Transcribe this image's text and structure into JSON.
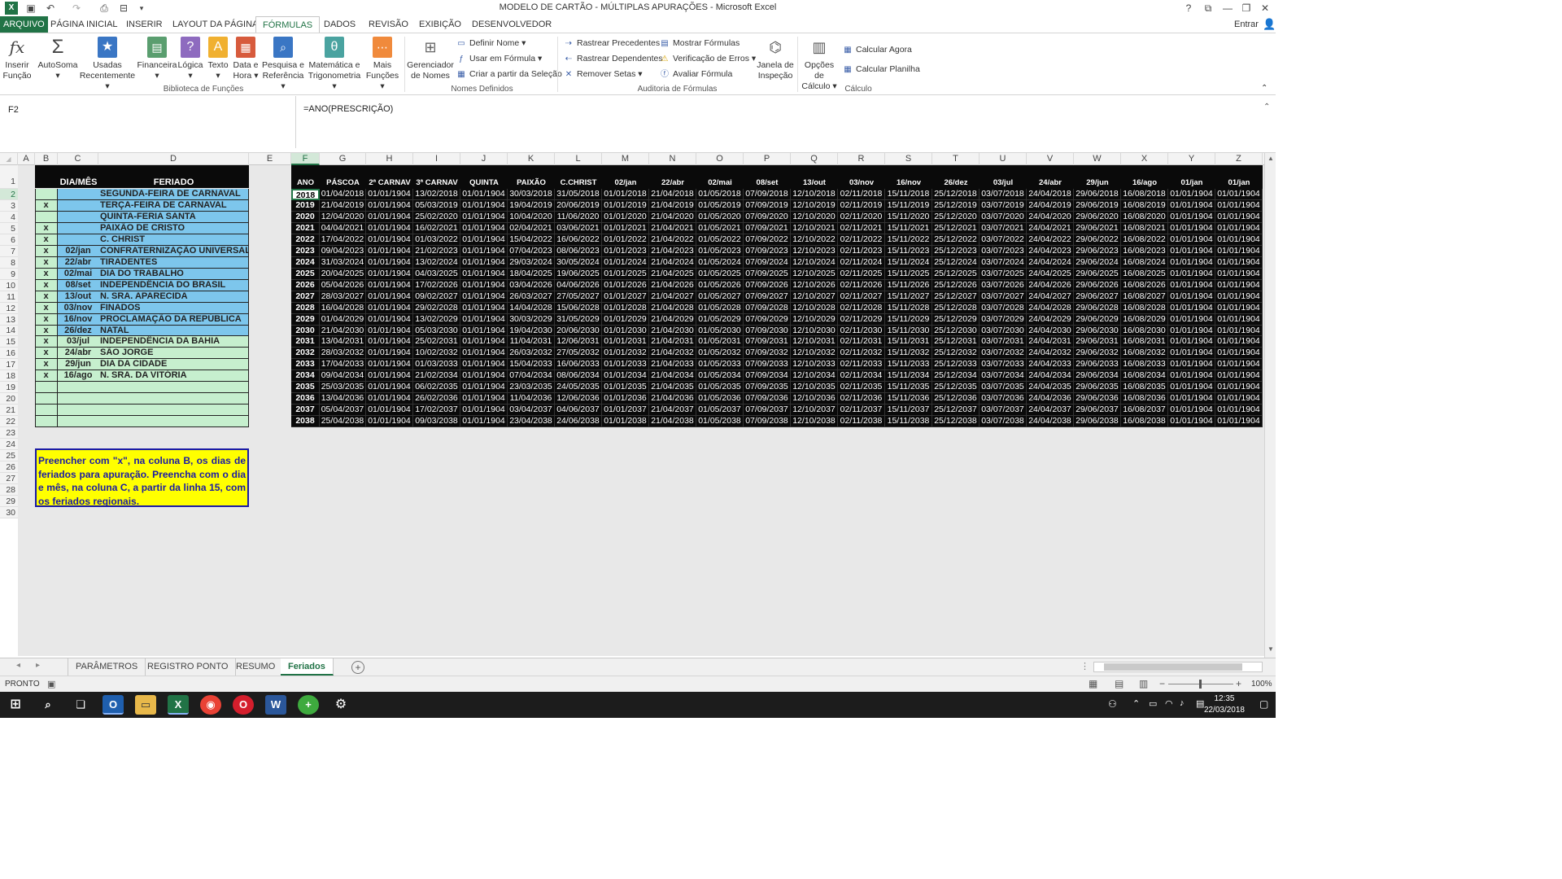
{
  "window": {
    "title": "MODELO DE CARTÃO - MÚLTIPLAS APURAÇÕES - Microsoft Excel",
    "help": "?",
    "login": "Entrar"
  },
  "ribbon_tabs": [
    "ARQUIVO",
    "PÁGINA INICIAL",
    "INSERIR",
    "LAYOUT DA PÁGINA",
    "FÓRMULAS",
    "DADOS",
    "REVISÃO",
    "EXIBIÇÃO",
    "DESENVOLVEDOR"
  ],
  "ribbon": {
    "lib_group": "Biblioteca de Funções",
    "names_group": "Nomes Definidos",
    "audit_group": "Auditoria de Fórmulas",
    "calc_group": "Cálculo",
    "buttons": {
      "inserir_funcao": [
        "Inserir",
        "Função"
      ],
      "autosoma": [
        "AutoSoma",
        "▾"
      ],
      "usadas": [
        "Usadas",
        "Recentemente ▾"
      ],
      "financeira": [
        "Financeira",
        "▾"
      ],
      "logica": [
        "Lógica",
        "▾"
      ],
      "texto": [
        "Texto",
        "▾"
      ],
      "data_hora": [
        "Data e",
        "Hora ▾"
      ],
      "pesquisa": [
        "Pesquisa e",
        "Referência ▾"
      ],
      "matematica": [
        "Matemática e",
        "Trigonometria ▾"
      ],
      "mais": [
        "Mais",
        "Funções ▾"
      ],
      "gerenciador": [
        "Gerenciador",
        "de Nomes"
      ],
      "janela": [
        "Janela de",
        "Inspeção"
      ],
      "opcoes": [
        "Opções de",
        "Cálculo ▾"
      ]
    },
    "small": {
      "definir_nome": "Definir Nome ▾",
      "usar_formula": "Usar em Fórmula ▾",
      "criar_selecao": "Criar a partir da Seleção",
      "rastrear_prec": "Rastrear Precedentes",
      "rastrear_dep": "Rastrear Dependentes",
      "remover_setas": "Remover Setas ▾",
      "mostrar_formulas": "Mostrar Fórmulas",
      "verificacao_erros": "Verificação de Erros ▾",
      "avaliar_formula": "Avaliar Fórmula",
      "calcular_agora": "Calcular Agora",
      "calcular_planilha": "Calcular Planilha"
    }
  },
  "formula_bar": {
    "name_box": "F2",
    "formula": "=ANO(PRESCRIÇÃO)"
  },
  "columns": [
    "A",
    "B",
    "C",
    "D",
    "E",
    "F",
    "G",
    "H",
    "I",
    "J",
    "K",
    "L",
    "M",
    "N",
    "O",
    "P",
    "Q",
    "R",
    "S",
    "T",
    "U",
    "V",
    "W",
    "X",
    "Y",
    "Z"
  ],
  "selected_column": "F",
  "rows": [
    "1",
    "2",
    "3",
    "4",
    "5",
    "6",
    "7",
    "8",
    "9",
    "10",
    "11",
    "12",
    "13",
    "14",
    "15",
    "16",
    "17",
    "18",
    "19",
    "20",
    "21",
    "22",
    "23",
    "24",
    "25",
    "26",
    "27",
    "28",
    "29",
    "30"
  ],
  "holidays": {
    "headers": {
      "dia_mes": "DIA/MÊS",
      "feriado": "FERIADO"
    },
    "rows": [
      {
        "b": "",
        "c": "",
        "d": "SEGUNDA-FEIRA DE CARNAVAL"
      },
      {
        "b": "x",
        "c": "",
        "d": "TERÇA-FEIRA DE CARNAVAL"
      },
      {
        "b": "",
        "c": "",
        "d": "QUINTA-FERIA SANTA"
      },
      {
        "b": "x",
        "c": "",
        "d": "PAIXÃO DE CRISTO"
      },
      {
        "b": "x",
        "c": "",
        "d": "C. CHRIST"
      },
      {
        "b": "x",
        "c": "02/jan",
        "d": "CONFRATERNIZAÇÃO UNIVERSAL"
      },
      {
        "b": "x",
        "c": "22/abr",
        "d": "TIRADENTES"
      },
      {
        "b": "x",
        "c": "02/mai",
        "d": "DIA DO TRABALHO"
      },
      {
        "b": "x",
        "c": "08/set",
        "d": "INDEPENDÊNCIA DO BRASIL"
      },
      {
        "b": "x",
        "c": "13/out",
        "d": "N. SRA. APARECIDA"
      },
      {
        "b": "x",
        "c": "03/nov",
        "d": "FINADOS"
      },
      {
        "b": "x",
        "c": "16/nov",
        "d": "PROCLAMAÇÃO DA REPÚBLICA"
      },
      {
        "b": "x",
        "c": "26/dez",
        "d": "NATAL"
      },
      {
        "b": "x",
        "c": "03/jul",
        "d": "INDEPENDÊNCIA DA BAHIA"
      },
      {
        "b": "x",
        "c": "24/abr",
        "d": "SÃO JORGE"
      },
      {
        "b": "x",
        "c": "29/jun",
        "d": "DIA DA CIDADE"
      },
      {
        "b": "x",
        "c": "16/ago",
        "d": "N. SRA. DA VITÓRIA"
      },
      {
        "b": "",
        "c": "",
        "d": ""
      },
      {
        "b": "",
        "c": "",
        "d": ""
      },
      {
        "b": "",
        "c": "",
        "d": ""
      },
      {
        "b": "",
        "c": "",
        "d": ""
      }
    ]
  },
  "date_table": {
    "headers": [
      "ANO",
      "PÁSCOA",
      "2ª CARNAV",
      "3ª CARNAV",
      "QUINTA",
      "PAIXÃO",
      "C.CHRIST",
      "02/jan",
      "22/abr",
      "02/mai",
      "08/set",
      "13/out",
      "03/nov",
      "16/nov",
      "26/dez",
      "03/jul",
      "24/abr",
      "29/jun",
      "16/ago",
      "01/jan",
      "01/jan"
    ],
    "rows": [
      [
        "2018",
        "01/04/2018",
        "01/01/1904",
        "13/02/2018",
        "01/01/1904",
        "30/03/2018",
        "31/05/2018",
        "01/01/2018",
        "21/04/2018",
        "01/05/2018",
        "07/09/2018",
        "12/10/2018",
        "02/11/2018",
        "15/11/2018",
        "25/12/2018",
        "03/07/2018",
        "24/04/2018",
        "29/06/2018",
        "16/08/2018",
        "01/01/1904",
        "01/01/1904"
      ],
      [
        "2019",
        "21/04/2019",
        "01/01/1904",
        "05/03/2019",
        "01/01/1904",
        "19/04/2019",
        "20/06/2019",
        "01/01/2019",
        "21/04/2019",
        "01/05/2019",
        "07/09/2019",
        "12/10/2019",
        "02/11/2019",
        "15/11/2019",
        "25/12/2019",
        "03/07/2019",
        "24/04/2019",
        "29/06/2019",
        "16/08/2019",
        "01/01/1904",
        "01/01/1904"
      ],
      [
        "2020",
        "12/04/2020",
        "01/01/1904",
        "25/02/2020",
        "01/01/1904",
        "10/04/2020",
        "11/06/2020",
        "01/01/2020",
        "21/04/2020",
        "01/05/2020",
        "07/09/2020",
        "12/10/2020",
        "02/11/2020",
        "15/11/2020",
        "25/12/2020",
        "03/07/2020",
        "24/04/2020",
        "29/06/2020",
        "16/08/2020",
        "01/01/1904",
        "01/01/1904"
      ],
      [
        "2021",
        "04/04/2021",
        "01/01/1904",
        "16/02/2021",
        "01/01/1904",
        "02/04/2021",
        "03/06/2021",
        "01/01/2021",
        "21/04/2021",
        "01/05/2021",
        "07/09/2021",
        "12/10/2021",
        "02/11/2021",
        "15/11/2021",
        "25/12/2021",
        "03/07/2021",
        "24/04/2021",
        "29/06/2021",
        "16/08/2021",
        "01/01/1904",
        "01/01/1904"
      ],
      [
        "2022",
        "17/04/2022",
        "01/01/1904",
        "01/03/2022",
        "01/01/1904",
        "15/04/2022",
        "16/06/2022",
        "01/01/2022",
        "21/04/2022",
        "01/05/2022",
        "07/09/2022",
        "12/10/2022",
        "02/11/2022",
        "15/11/2022",
        "25/12/2022",
        "03/07/2022",
        "24/04/2022",
        "29/06/2022",
        "16/08/2022",
        "01/01/1904",
        "01/01/1904"
      ],
      [
        "2023",
        "09/04/2023",
        "01/01/1904",
        "21/02/2023",
        "01/01/1904",
        "07/04/2023",
        "08/06/2023",
        "01/01/2023",
        "21/04/2023",
        "01/05/2023",
        "07/09/2023",
        "12/10/2023",
        "02/11/2023",
        "15/11/2023",
        "25/12/2023",
        "03/07/2023",
        "24/04/2023",
        "29/06/2023",
        "16/08/2023",
        "01/01/1904",
        "01/01/1904"
      ],
      [
        "2024",
        "31/03/2024",
        "01/01/1904",
        "13/02/2024",
        "01/01/1904",
        "29/03/2024",
        "30/05/2024",
        "01/01/2024",
        "21/04/2024",
        "01/05/2024",
        "07/09/2024",
        "12/10/2024",
        "02/11/2024",
        "15/11/2024",
        "25/12/2024",
        "03/07/2024",
        "24/04/2024",
        "29/06/2024",
        "16/08/2024",
        "01/01/1904",
        "01/01/1904"
      ],
      [
        "2025",
        "20/04/2025",
        "01/01/1904",
        "04/03/2025",
        "01/01/1904",
        "18/04/2025",
        "19/06/2025",
        "01/01/2025",
        "21/04/2025",
        "01/05/2025",
        "07/09/2025",
        "12/10/2025",
        "02/11/2025",
        "15/11/2025",
        "25/12/2025",
        "03/07/2025",
        "24/04/2025",
        "29/06/2025",
        "16/08/2025",
        "01/01/1904",
        "01/01/1904"
      ],
      [
        "2026",
        "05/04/2026",
        "01/01/1904",
        "17/02/2026",
        "01/01/1904",
        "03/04/2026",
        "04/06/2026",
        "01/01/2026",
        "21/04/2026",
        "01/05/2026",
        "07/09/2026",
        "12/10/2026",
        "02/11/2026",
        "15/11/2026",
        "25/12/2026",
        "03/07/2026",
        "24/04/2026",
        "29/06/2026",
        "16/08/2026",
        "01/01/1904",
        "01/01/1904"
      ],
      [
        "2027",
        "28/03/2027",
        "01/01/1904",
        "09/02/2027",
        "01/01/1904",
        "26/03/2027",
        "27/05/2027",
        "01/01/2027",
        "21/04/2027",
        "01/05/2027",
        "07/09/2027",
        "12/10/2027",
        "02/11/2027",
        "15/11/2027",
        "25/12/2027",
        "03/07/2027",
        "24/04/2027",
        "29/06/2027",
        "16/08/2027",
        "01/01/1904",
        "01/01/1904"
      ],
      [
        "2028",
        "16/04/2028",
        "01/01/1904",
        "29/02/2028",
        "01/01/1904",
        "14/04/2028",
        "15/06/2028",
        "01/01/2028",
        "21/04/2028",
        "01/05/2028",
        "07/09/2028",
        "12/10/2028",
        "02/11/2028",
        "15/11/2028",
        "25/12/2028",
        "03/07/2028",
        "24/04/2028",
        "29/06/2028",
        "16/08/2028",
        "01/01/1904",
        "01/01/1904"
      ],
      [
        "2029",
        "01/04/2029",
        "01/01/1904",
        "13/02/2029",
        "01/01/1904",
        "30/03/2029",
        "31/05/2029",
        "01/01/2029",
        "21/04/2029",
        "01/05/2029",
        "07/09/2029",
        "12/10/2029",
        "02/11/2029",
        "15/11/2029",
        "25/12/2029",
        "03/07/2029",
        "24/04/2029",
        "29/06/2029",
        "16/08/2029",
        "01/01/1904",
        "01/01/1904"
      ],
      [
        "2030",
        "21/04/2030",
        "01/01/1904",
        "05/03/2030",
        "01/01/1904",
        "19/04/2030",
        "20/06/2030",
        "01/01/2030",
        "21/04/2030",
        "01/05/2030",
        "07/09/2030",
        "12/10/2030",
        "02/11/2030",
        "15/11/2030",
        "25/12/2030",
        "03/07/2030",
        "24/04/2030",
        "29/06/2030",
        "16/08/2030",
        "01/01/1904",
        "01/01/1904"
      ],
      [
        "2031",
        "13/04/2031",
        "01/01/1904",
        "25/02/2031",
        "01/01/1904",
        "11/04/2031",
        "12/06/2031",
        "01/01/2031",
        "21/04/2031",
        "01/05/2031",
        "07/09/2031",
        "12/10/2031",
        "02/11/2031",
        "15/11/2031",
        "25/12/2031",
        "03/07/2031",
        "24/04/2031",
        "29/06/2031",
        "16/08/2031",
        "01/01/1904",
        "01/01/1904"
      ],
      [
        "2032",
        "28/03/2032",
        "01/01/1904",
        "10/02/2032",
        "01/01/1904",
        "26/03/2032",
        "27/05/2032",
        "01/01/2032",
        "21/04/2032",
        "01/05/2032",
        "07/09/2032",
        "12/10/2032",
        "02/11/2032",
        "15/11/2032",
        "25/12/2032",
        "03/07/2032",
        "24/04/2032",
        "29/06/2032",
        "16/08/2032",
        "01/01/1904",
        "01/01/1904"
      ],
      [
        "2033",
        "17/04/2033",
        "01/01/1904",
        "01/03/2033",
        "01/01/1904",
        "15/04/2033",
        "16/06/2033",
        "01/01/2033",
        "21/04/2033",
        "01/05/2033",
        "07/09/2033",
        "12/10/2033",
        "02/11/2033",
        "15/11/2033",
        "25/12/2033",
        "03/07/2033",
        "24/04/2033",
        "29/06/2033",
        "16/08/2033",
        "01/01/1904",
        "01/01/1904"
      ],
      [
        "2034",
        "09/04/2034",
        "01/01/1904",
        "21/02/2034",
        "01/01/1904",
        "07/04/2034",
        "08/06/2034",
        "01/01/2034",
        "21/04/2034",
        "01/05/2034",
        "07/09/2034",
        "12/10/2034",
        "02/11/2034",
        "15/11/2034",
        "25/12/2034",
        "03/07/2034",
        "24/04/2034",
        "29/06/2034",
        "16/08/2034",
        "01/01/1904",
        "01/01/1904"
      ],
      [
        "2035",
        "25/03/2035",
        "01/01/1904",
        "06/02/2035",
        "01/01/1904",
        "23/03/2035",
        "24/05/2035",
        "01/01/2035",
        "21/04/2035",
        "01/05/2035",
        "07/09/2035",
        "12/10/2035",
        "02/11/2035",
        "15/11/2035",
        "25/12/2035",
        "03/07/2035",
        "24/04/2035",
        "29/06/2035",
        "16/08/2035",
        "01/01/1904",
        "01/01/1904"
      ],
      [
        "2036",
        "13/04/2036",
        "01/01/1904",
        "26/02/2036",
        "01/01/1904",
        "11/04/2036",
        "12/06/2036",
        "01/01/2036",
        "21/04/2036",
        "01/05/2036",
        "07/09/2036",
        "12/10/2036",
        "02/11/2036",
        "15/11/2036",
        "25/12/2036",
        "03/07/2036",
        "24/04/2036",
        "29/06/2036",
        "16/08/2036",
        "01/01/1904",
        "01/01/1904"
      ],
      [
        "2037",
        "05/04/2037",
        "01/01/1904",
        "17/02/2037",
        "01/01/1904",
        "03/04/2037",
        "04/06/2037",
        "01/01/2037",
        "21/04/2037",
        "01/05/2037",
        "07/09/2037",
        "12/10/2037",
        "02/11/2037",
        "15/11/2037",
        "25/12/2037",
        "03/07/2037",
        "24/04/2037",
        "29/06/2037",
        "16/08/2037",
        "01/01/1904",
        "01/01/1904"
      ],
      [
        "2038",
        "25/04/2038",
        "01/01/1904",
        "09/03/2038",
        "01/01/1904",
        "23/04/2038",
        "24/06/2038",
        "01/01/2038",
        "21/04/2038",
        "01/05/2038",
        "07/09/2038",
        "12/10/2038",
        "02/11/2038",
        "15/11/2038",
        "25/12/2038",
        "03/07/2038",
        "24/04/2038",
        "29/06/2038",
        "16/08/2038",
        "01/01/1904",
        "01/01/1904"
      ]
    ]
  },
  "note": "Preencher com \"x\", na coluna B, os dias de feriados para apuração. Preencha com o dia e mês, na coluna C, a partir da linha 15, com os feriados regionais.",
  "sheet_tabs": [
    "PARÂMETROS",
    "REGISTRO PONTO",
    "RESUMO",
    "Feriados"
  ],
  "active_sheet": "Feriados",
  "status": {
    "mode": "PRONTO",
    "zoom": "100%"
  },
  "taskbar": {
    "time": "12:35",
    "date": "22/03/2018"
  },
  "colors": {
    "excel_green": "#217346",
    "holiday_blue": "#7dc6ec",
    "holiday_green": "#c6efce",
    "note_yellow": "#ffff00",
    "note_text": "#1a1aa6"
  }
}
